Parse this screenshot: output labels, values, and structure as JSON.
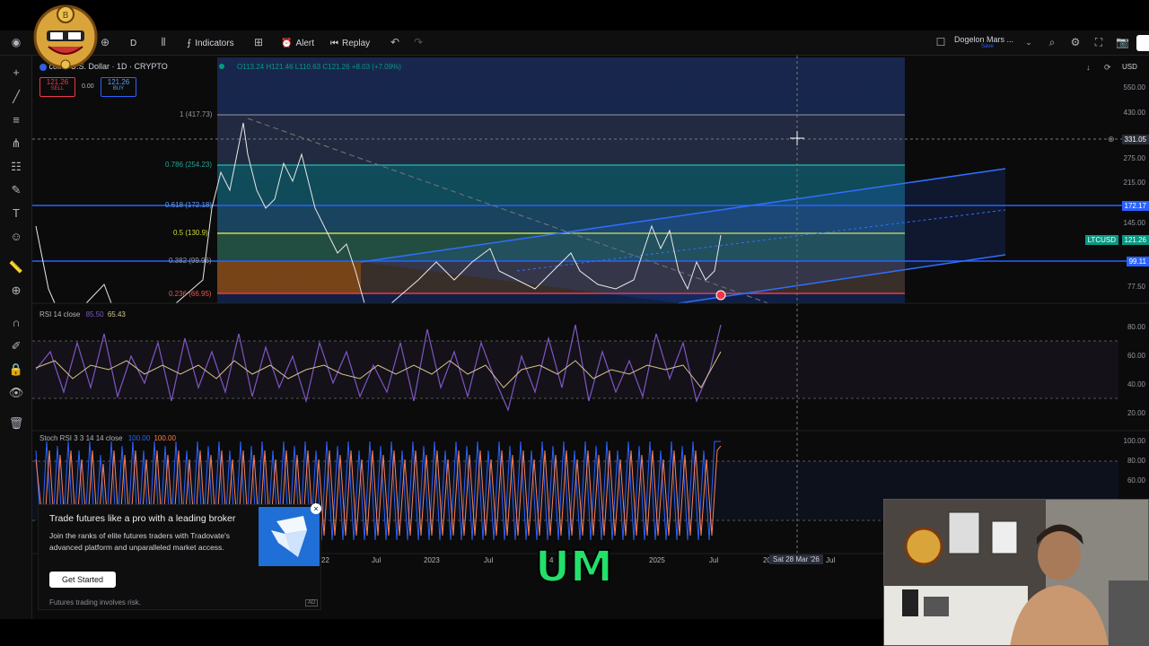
{
  "toolbar": {
    "interval": "D",
    "indicators_label": "Indicators",
    "alert_label": "Alert",
    "replay_label": "Replay",
    "layout_name": "Dogelon Mars ...",
    "layout_sub": "Save"
  },
  "symbol": {
    "title": "coin / U.S. Dollar · 1D · CRYPTO",
    "ohlc": "O113.24 H121.46 L110.63 C121.26 +8.03 (+7.09%)",
    "sell_price": "121.26",
    "sell_label": "SELL",
    "spread": "0.00",
    "buy_price": "121.26",
    "buy_label": "BUY",
    "currency": "USD"
  },
  "price_scale": [
    "550.00",
    "430.00",
    "275.00",
    "215.00",
    "145.00",
    "77.50"
  ],
  "price_badges": {
    "crosshair": "331.05",
    "level_blue": "172.17",
    "ticker": "LTCUSD",
    "last": "121.26",
    "level_low": "99.11"
  },
  "fib_levels": [
    {
      "label": "1 (417.73)",
      "color": "#9598a1"
    },
    {
      "label": "0.786 (254.23)",
      "color": "#26a69a"
    },
    {
      "label": "0.618 (172.18)",
      "color": "#5b9cf6"
    },
    {
      "label": "0.5 (130.9)",
      "color": "#cddc39"
    },
    {
      "label": "0.382 (99.96)",
      "color": "#9598a1"
    },
    {
      "label": "0.236 (66.95)",
      "color": "#ef5350"
    }
  ],
  "rsi": {
    "label": "RSI 14 close",
    "v1": "85.50",
    "v2": "65.43",
    "scale": [
      "80.00",
      "60.00",
      "40.00",
      "20.00"
    ]
  },
  "stoch": {
    "label": "Stoch RSI 3 3 14 14 close",
    "v1": "100.00",
    "v2": "100.00",
    "scale": [
      "100.00",
      "80.00",
      "60.00"
    ]
  },
  "time_axis": [
    "22",
    "Jul",
    "2023",
    "Jul",
    "4",
    "2025",
    "Jul",
    "20",
    "Jul"
  ],
  "crosshair_date": "Sat 28 Mar '26",
  "ad": {
    "title": "Trade futures like a pro with a leading broker",
    "body": "Join the ranks of elite futures traders with Tradovate's advanced platform and unparalleled market access.",
    "cta": "Get Started",
    "disclaimer": "Futures trading involves risk.",
    "ad_tag": "AD"
  },
  "caption": "UM",
  "colors": {
    "accent": "#2962ff",
    "red": "#f23645",
    "green": "#089981",
    "caption": "#22e06a"
  }
}
